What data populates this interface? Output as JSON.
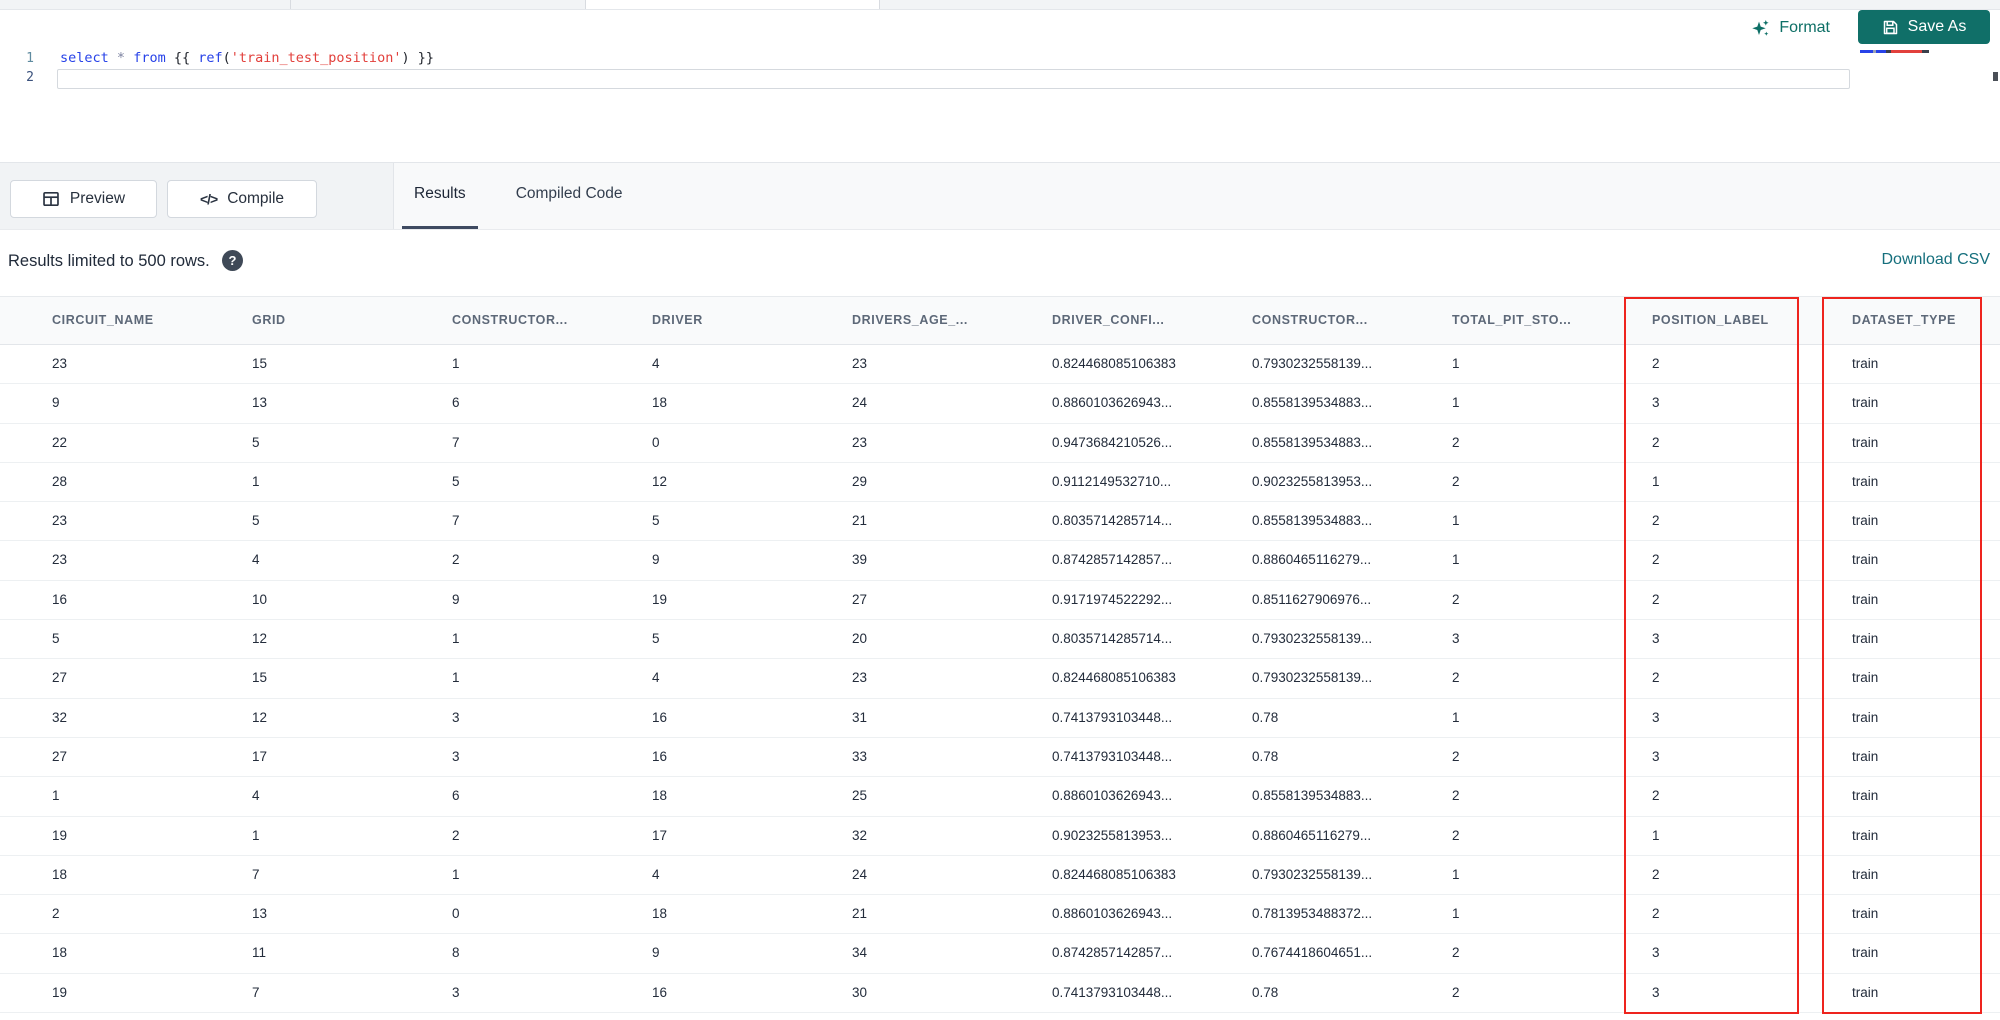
{
  "toolbar": {
    "format_label": "Format",
    "save_as_label": "Save As"
  },
  "editor": {
    "line1_number": "1",
    "line2_number": "2",
    "code_tokens": [
      {
        "text": "select",
        "type": "keyword"
      },
      {
        "text": " ",
        "type": "plain"
      },
      {
        "text": "*",
        "type": "operator"
      },
      {
        "text": " ",
        "type": "plain"
      },
      {
        "text": "from",
        "type": "keyword"
      },
      {
        "text": " {{ ",
        "type": "plain"
      },
      {
        "text": "ref",
        "type": "keyword"
      },
      {
        "text": "(",
        "type": "plain"
      },
      {
        "text": "'train_test_position'",
        "type": "string"
      },
      {
        "text": ")",
        "type": "plain"
      },
      {
        "text": " }}",
        "type": "plain"
      }
    ]
  },
  "actions": {
    "preview_label": "Preview",
    "compile_label": "Compile",
    "compile_glyph": "</>"
  },
  "tabs": [
    {
      "label": "Results",
      "active": true
    },
    {
      "label": "Compiled Code",
      "active": false
    }
  ],
  "results_bar": {
    "limit_text": "Results limited to 500 rows.",
    "help_glyph": "?",
    "download_label": "Download CSV"
  },
  "table": {
    "columns": [
      "CIRCUIT_NAME",
      "GRID",
      "CONSTRUCTOR...",
      "DRIVER",
      "DRIVERS_AGE_...",
      "DRIVER_CONFI...",
      "CONSTRUCTOR...",
      "TOTAL_PIT_STO...",
      "POSITION_LABEL",
      "DATASET_TYPE"
    ],
    "rows": [
      [
        "23",
        "15",
        "1",
        "4",
        "23",
        "0.824468085106383",
        "0.7930232558139...",
        "1",
        "2",
        "train"
      ],
      [
        "9",
        "13",
        "6",
        "18",
        "24",
        "0.8860103626943...",
        "0.8558139534883...",
        "1",
        "3",
        "train"
      ],
      [
        "22",
        "5",
        "7",
        "0",
        "23",
        "0.9473684210526...",
        "0.8558139534883...",
        "2",
        "2",
        "train"
      ],
      [
        "28",
        "1",
        "5",
        "12",
        "29",
        "0.9112149532710...",
        "0.9023255813953...",
        "2",
        "1",
        "train"
      ],
      [
        "23",
        "5",
        "7",
        "5",
        "21",
        "0.8035714285714...",
        "0.8558139534883...",
        "1",
        "2",
        "train"
      ],
      [
        "23",
        "4",
        "2",
        "9",
        "39",
        "0.8742857142857...",
        "0.8860465116279...",
        "1",
        "2",
        "train"
      ],
      [
        "16",
        "10",
        "9",
        "19",
        "27",
        "0.9171974522292...",
        "0.8511627906976...",
        "2",
        "2",
        "train"
      ],
      [
        "5",
        "12",
        "1",
        "5",
        "20",
        "0.8035714285714...",
        "0.7930232558139...",
        "3",
        "3",
        "train"
      ],
      [
        "27",
        "15",
        "1",
        "4",
        "23",
        "0.824468085106383",
        "0.7930232558139...",
        "2",
        "2",
        "train"
      ],
      [
        "32",
        "12",
        "3",
        "16",
        "31",
        "0.7413793103448...",
        "0.78",
        "1",
        "3",
        "train"
      ],
      [
        "27",
        "17",
        "3",
        "16",
        "33",
        "0.7413793103448...",
        "0.78",
        "2",
        "3",
        "train"
      ],
      [
        "1",
        "4",
        "6",
        "18",
        "25",
        "0.8860103626943...",
        "0.8558139534883...",
        "2",
        "2",
        "train"
      ],
      [
        "19",
        "1",
        "2",
        "17",
        "32",
        "0.9023255813953...",
        "0.8860465116279...",
        "2",
        "1",
        "train"
      ],
      [
        "18",
        "7",
        "1",
        "4",
        "24",
        "0.824468085106383",
        "0.7930232558139...",
        "1",
        "2",
        "train"
      ],
      [
        "2",
        "13",
        "0",
        "18",
        "21",
        "0.8860103626943...",
        "0.7813953488372...",
        "1",
        "2",
        "train"
      ],
      [
        "18",
        "11",
        "8",
        "9",
        "34",
        "0.8742857142857...",
        "0.7674418604651...",
        "2",
        "3",
        "train"
      ],
      [
        "19",
        "7",
        "3",
        "16",
        "30",
        "0.7413793103448...",
        "0.78",
        "2",
        "3",
        "train"
      ]
    ],
    "highlight": {
      "color": "#ee241e",
      "highlighted_columns": [
        "POSITION_LABEL",
        "DATASET_TYPE"
      ]
    }
  },
  "colors": {
    "accent_teal": "#106f68",
    "download_link_teal": "#156f7d",
    "keyword_blue": "#2742e8",
    "string_red": "#e2403c",
    "highlight_red": "#ee241e"
  }
}
